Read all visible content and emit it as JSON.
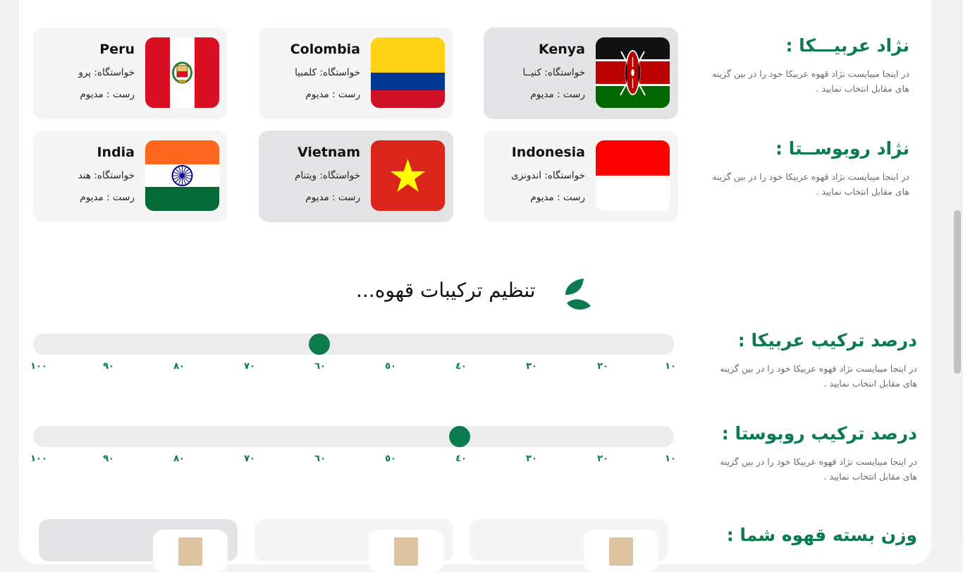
{
  "sections": {
    "arabica_race": {
      "title": "نژاد عربیـــکا :",
      "desc": "در اینجا میبایست نژاد قهوه عربیکا خود را در بین گزینه های مقابل انتخاب نمایید ."
    },
    "robusta_race": {
      "title": "نژاد روبوســتا :",
      "desc": "در اینجا میبایست نژاد قهوه عربیکا خود را در بین گزینه های مقابل انتخاب نمایید ."
    }
  },
  "cards": [
    {
      "name": "Kenya",
      "origin": "خواستگاه: کنیــا",
      "roast": "رست : مدیوم",
      "selected": true,
      "flag": "kenya-flag"
    },
    {
      "name": "Colombia",
      "origin": "خواستگاه: کلمبیا",
      "roast": "رست : مدیوم",
      "selected": false,
      "flag": "colombia-flag"
    },
    {
      "name": "Peru",
      "origin": "خواستگاه: پرو",
      "roast": "رست : مدیوم",
      "selected": false,
      "flag": "peru-flag"
    },
    {
      "name": "Indonesia",
      "origin": "خواستگاه: اندونزی",
      "roast": "رست : مدیوم",
      "selected": false,
      "flag": "indonesia-flag"
    },
    {
      "name": "Vietnam",
      "origin": "خواستگاه: ویتنام",
      "roast": "رست : مدیوم",
      "selected": true,
      "flag": "vietnam-flag"
    },
    {
      "name": "India",
      "origin": "خواستگاه: هند",
      "roast": "رست : مدیوم",
      "selected": false,
      "flag": "india-flag"
    }
  ],
  "heading": "تنظیم ترکیبات قهوه...",
  "sliders": {
    "arabica": {
      "title": "درصد ترکیب عربیکا :",
      "desc": "در اینجا میبایست نژاد قهوه عربیکا خود را در بین گزینه های مقابل انتخاب نمایید .",
      "value": 60
    },
    "robusta": {
      "title": "درصد ترکیب روبوستا :",
      "desc": "در اینجا میبایست نژاد قهوه عربیکا خود را در بین گزینه های مقابل انتخاب نمایید .",
      "value": 40
    },
    "scale": [
      "١٠٠",
      "٩٠",
      "٨٠",
      "٧٠",
      "٦٠",
      "٥٠",
      "٤٠",
      "٣٠",
      "٢٠",
      "١٠"
    ]
  },
  "weight_section": {
    "title": "وزن بسته قهوه شما :"
  },
  "colors": {
    "accent": "#0b7a4e",
    "card": "#f5f5f5",
    "card_selected": "#e4e4e6"
  }
}
